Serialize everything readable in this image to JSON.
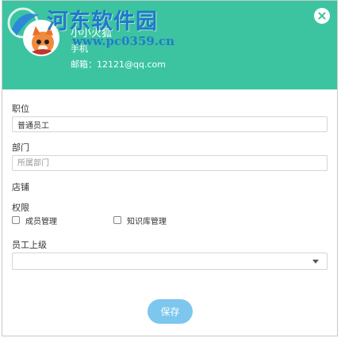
{
  "watermark": {
    "brand": "河东软件园",
    "url": "www.pc0359.cn"
  },
  "profile": {
    "name": "小小火狐",
    "phone_label": "手机",
    "email_text": "邮箱：12121@qq.com"
  },
  "form": {
    "position": {
      "label": "职位",
      "value": "普通员工"
    },
    "department": {
      "label": "部门",
      "placeholder": "所属部门"
    },
    "store": {
      "label": "店铺"
    },
    "permissions": {
      "label": "权限",
      "options": [
        {
          "label": "成员管理",
          "checked": false
        },
        {
          "label": "知识库管理",
          "checked": false
        }
      ]
    },
    "superior": {
      "label": "员工上级",
      "selected": ""
    }
  },
  "actions": {
    "save_label": "保存"
  },
  "colors": {
    "header": "#3cc4a1",
    "save_button": "#7dc6ee",
    "watermark": "#1f6fcf"
  }
}
